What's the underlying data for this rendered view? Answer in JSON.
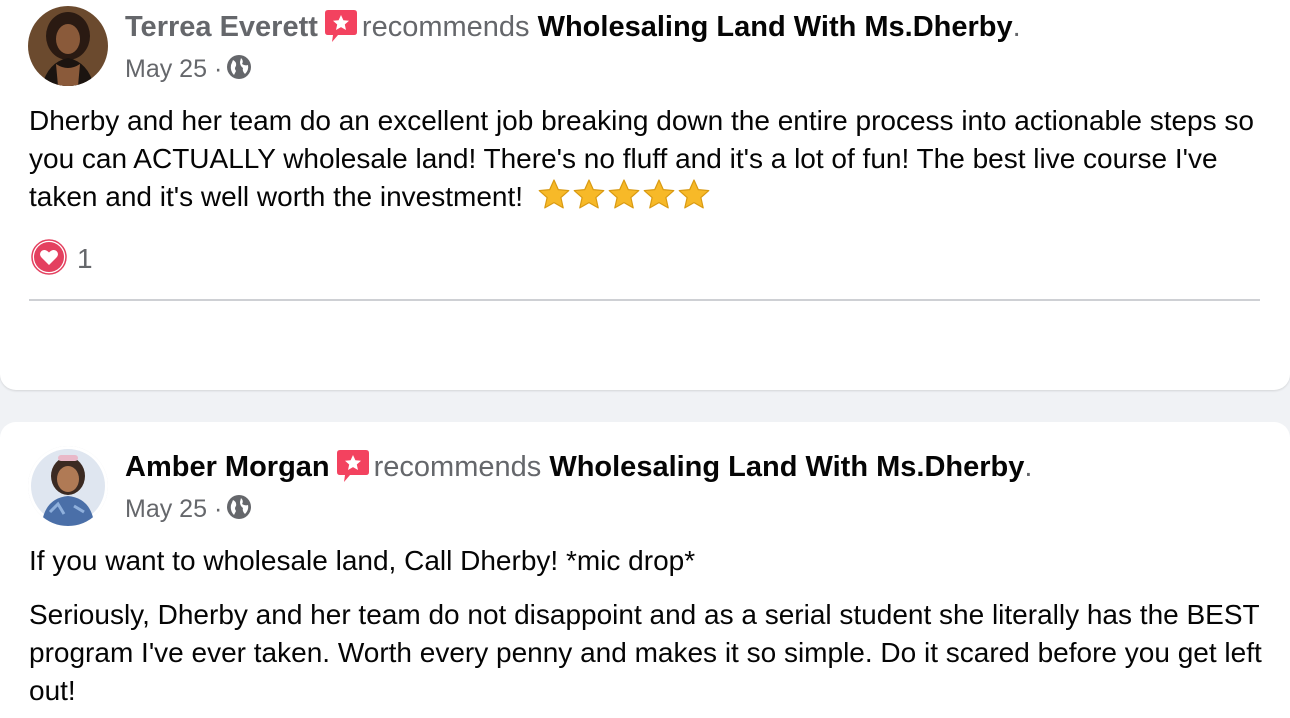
{
  "reviews": [
    {
      "author": "Terrea Everett",
      "verb": "recommends",
      "page": "Wholesaling Land With Ms.Dherby",
      "period": ".",
      "date": "May 25",
      "separator": "·",
      "privacy_icon": "globe-icon",
      "text": "Dherby and her team do an excellent job breaking down the entire process into actionable steps so you can ACTUALLY wholesale land! There's no fluff and it's a lot of fun! The best live course I've taken and it's well worth the investment!",
      "stars": 5,
      "reaction_icon": "love-reaction-icon",
      "reaction_count": "1"
    },
    {
      "author": "Amber Morgan",
      "verb": "recommends",
      "page": "Wholesaling Land With Ms.Dherby",
      "period": ".",
      "date": "May 25",
      "separator": "·",
      "privacy_icon": "globe-icon",
      "paragraphs": [
        "If you want to wholesale land, Call Dherby! *mic drop*",
        "Seriously, Dherby and her team do not disappoint and as a serial student she literally has the BEST program I've ever taken. Worth every penny and makes it so simple. Do it scared before you get left out!"
      ]
    }
  ],
  "colors": {
    "background": "#f0f2f5",
    "card": "#ffffff",
    "text": "#050505",
    "muted": "#65676b",
    "recommend_badge": "#f3425f",
    "heart": "#e4405f",
    "star": "#f7b928"
  }
}
